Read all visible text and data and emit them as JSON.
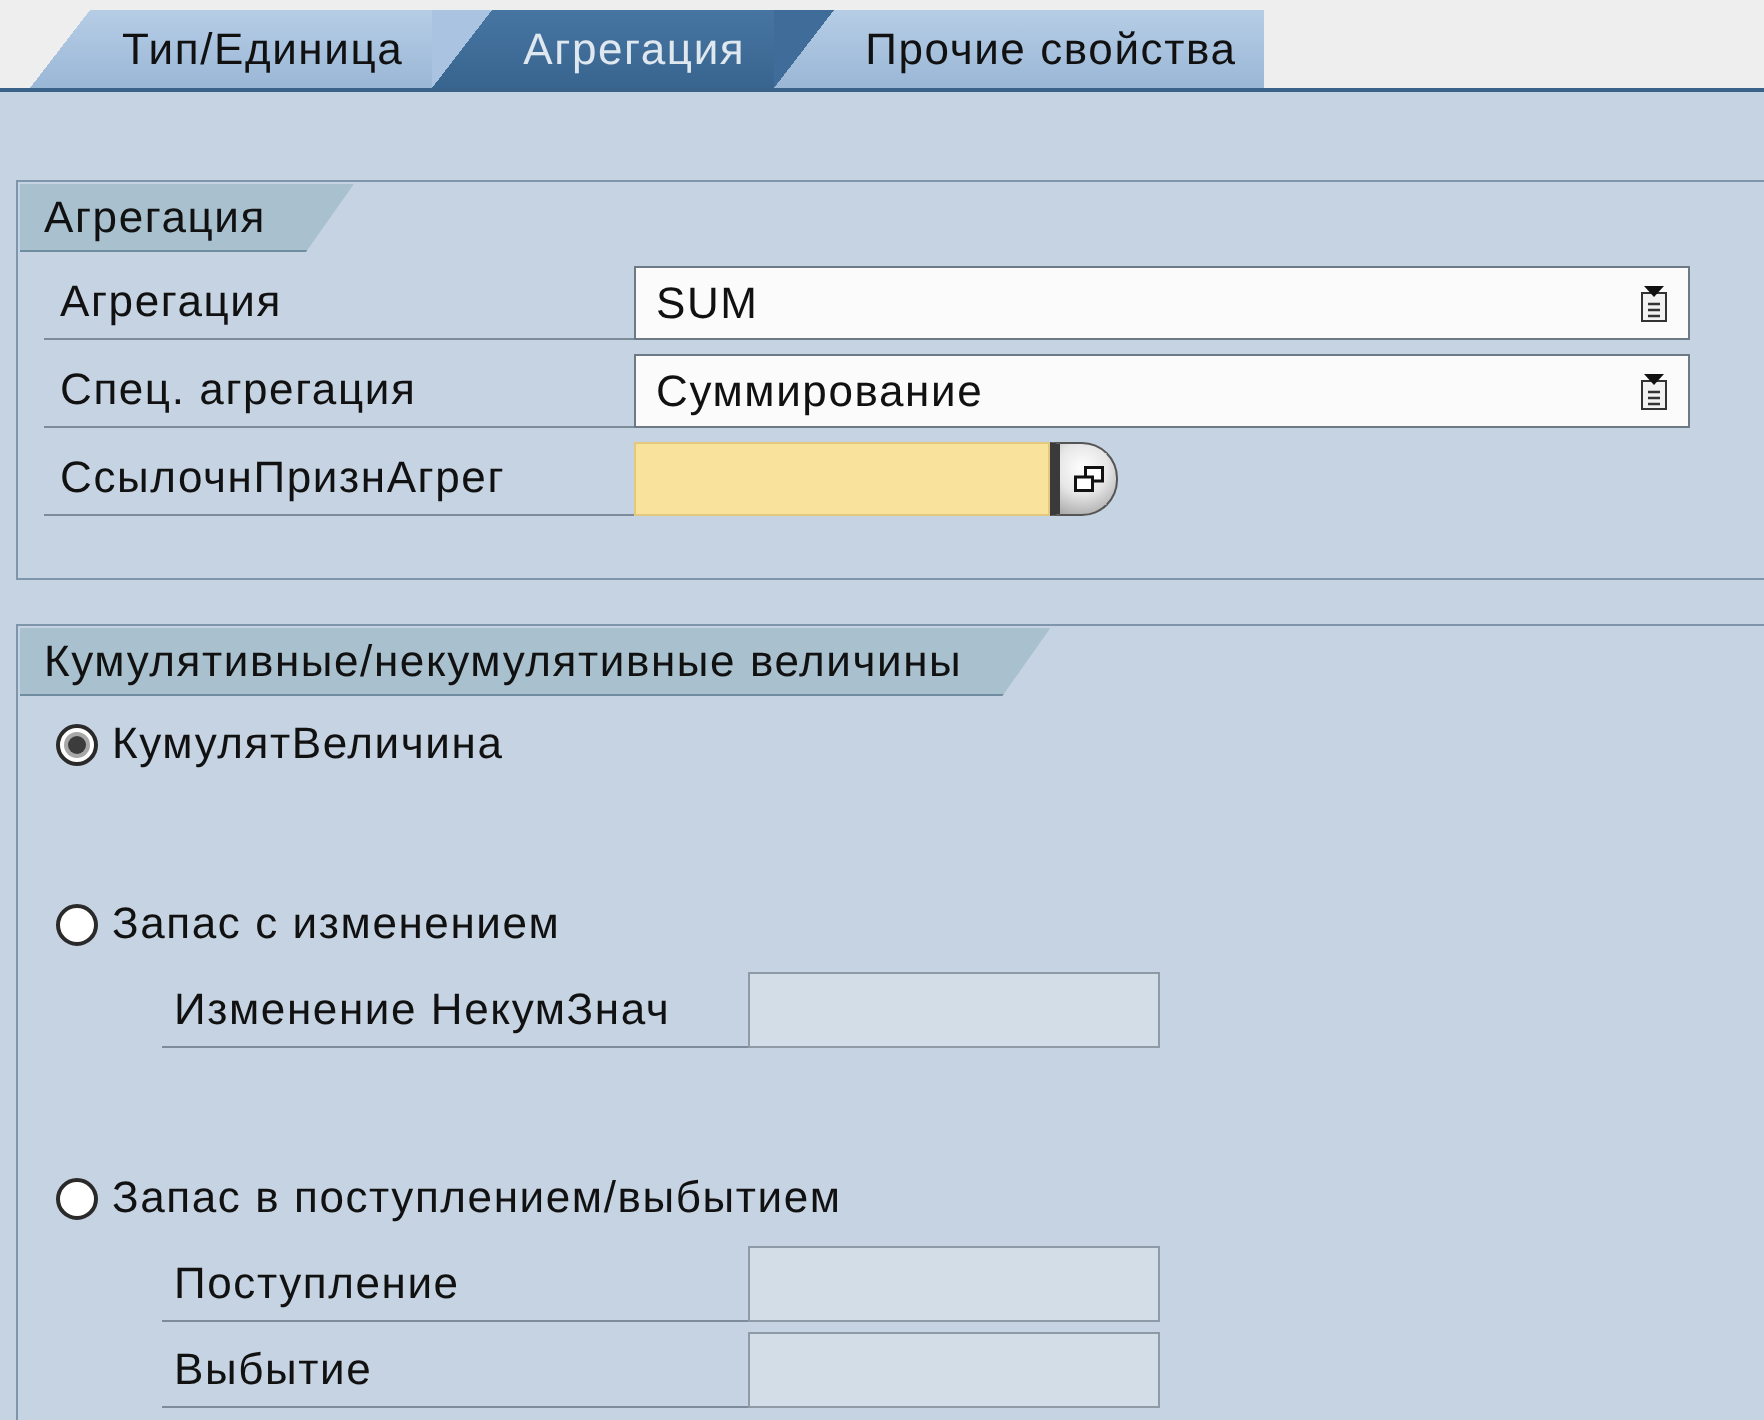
{
  "tabs": [
    {
      "label": "Тип/Единица",
      "selected": false
    },
    {
      "label": "Агрегация",
      "selected": true
    },
    {
      "label": "Прочие свойства",
      "selected": false
    }
  ],
  "aggregation_group": {
    "title": "Агрегация",
    "fields": [
      {
        "kind": "dropdown",
        "label": "Агрегация",
        "value": "SUM",
        "highlighted": false
      },
      {
        "kind": "dropdown",
        "label": "Спец. агрегация",
        "value": "Суммирование",
        "highlighted": false
      },
      {
        "kind": "lookup",
        "label": "СсылочнПризнАгрег",
        "highlighted": true
      }
    ]
  },
  "cumulative_group": {
    "title": "Кумулятивные/некумулятивные величины",
    "options": [
      {
        "label": "КумулятВеличина",
        "selected": true
      },
      {
        "label": "Запас с изменением",
        "selected": false,
        "fields": [
          {
            "label": "Изменение НекумЗнач",
            "disabled": true
          }
        ]
      },
      {
        "label": "Запас в поступлением/выбытием",
        "selected": false,
        "fields": [
          {
            "label": "Поступление",
            "disabled": true
          },
          {
            "label": "Выбытие",
            "disabled": true
          }
        ]
      }
    ]
  }
}
